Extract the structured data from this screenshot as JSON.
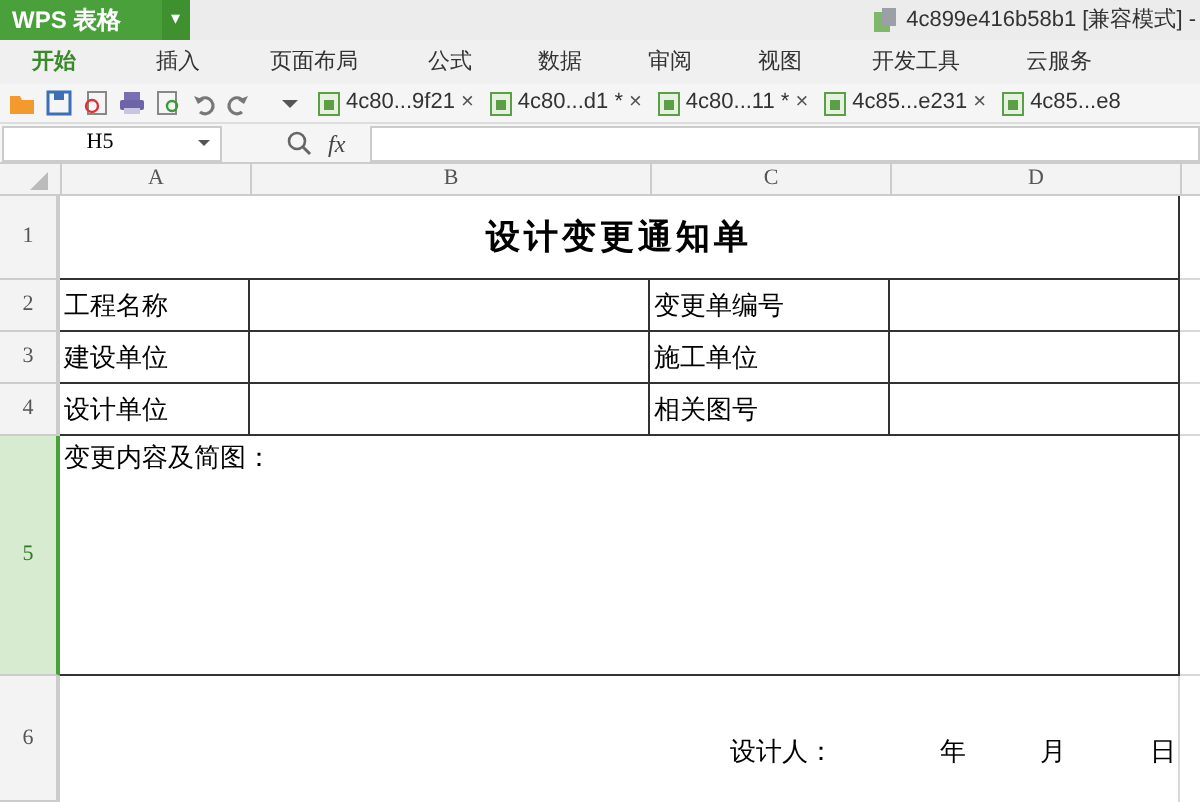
{
  "app_button": {
    "label": "WPS 表格",
    "caret": "▾"
  },
  "window": {
    "title": "4c899e416b58b1 [兼容模式] -"
  },
  "menu": [
    {
      "label": "开始",
      "selected": true
    },
    {
      "label": "插入",
      "selected": false
    },
    {
      "label": "页面布局",
      "selected": false
    },
    {
      "label": "公式",
      "selected": false
    },
    {
      "label": "数据",
      "selected": false
    },
    {
      "label": "审阅",
      "selected": false
    },
    {
      "label": "视图",
      "selected": false
    },
    {
      "label": "开发工具",
      "selected": false
    },
    {
      "label": "云服务",
      "selected": false
    }
  ],
  "doc_tabs": [
    {
      "label": "4c80...9f21",
      "close": "×"
    },
    {
      "label": "4c80...d1 *",
      "close": "×"
    },
    {
      "label": "4c80...11 *",
      "close": "×"
    },
    {
      "label": "4c85...e231",
      "close": "×"
    },
    {
      "label": "4c85...e8"
    }
  ],
  "formula_bar": {
    "name_box": "H5",
    "fx": "fx"
  },
  "columns": [
    "A",
    "B",
    "C",
    "D"
  ],
  "rows": [
    {
      "number": "1",
      "selected": false,
      "kind": "title",
      "cells": [
        "设计变更通知单"
      ]
    },
    {
      "number": "2",
      "selected": false,
      "kind": "pair",
      "cells": [
        "工程名称",
        "",
        "变更单编号",
        ""
      ]
    },
    {
      "number": "3",
      "selected": false,
      "kind": "pair",
      "cells": [
        "建设单位",
        "",
        "施工单位",
        ""
      ]
    },
    {
      "number": "4",
      "selected": false,
      "kind": "pair",
      "cells": [
        "设计单位",
        "",
        "相关图号",
        ""
      ]
    },
    {
      "number": "5",
      "selected": true,
      "kind": "merged",
      "cells": [
        "变更内容及简图："
      ]
    },
    {
      "number": "6",
      "selected": false,
      "kind": "sign",
      "cells": [
        "设计人：",
        "年",
        "月",
        "日"
      ]
    }
  ]
}
